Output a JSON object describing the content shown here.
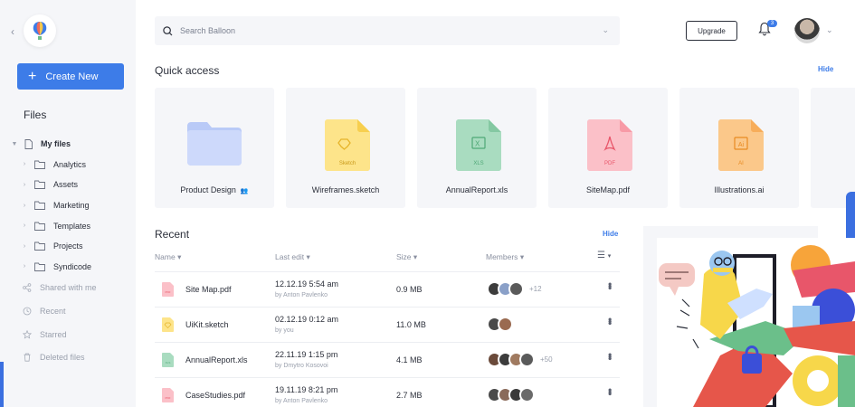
{
  "sidebar": {
    "create_label": "Create New",
    "files_title": "Files",
    "my_files": "My files",
    "folders": [
      "Analytics",
      "Assets",
      "Marketing",
      "Templates",
      "Projects",
      "Syndicode"
    ],
    "nav": [
      {
        "label": "Shared with me",
        "icon": "share-icon"
      },
      {
        "label": "Recent",
        "icon": "clock-icon"
      },
      {
        "label": "Starred",
        "icon": "star-icon"
      },
      {
        "label": "Deleted files",
        "icon": "trash-icon"
      }
    ]
  },
  "header": {
    "search_placeholder": "Search Balloon",
    "upgrade_label": "Upgrade",
    "notification_count": "3"
  },
  "quick_access": {
    "title": "Quick access",
    "hide_label": "Hide",
    "items": [
      {
        "name": "Product Design",
        "type": "folder"
      },
      {
        "name": "Wireframes.sketch",
        "type": "sketch",
        "tag": "Sketch"
      },
      {
        "name": "AnnualReport.xls",
        "type": "xls",
        "tag": "XLS"
      },
      {
        "name": "SiteMap.pdf",
        "type": "pdf",
        "tag": "PDF"
      },
      {
        "name": "Illustrations.ai",
        "type": "ai",
        "tag": "AI"
      }
    ]
  },
  "recent": {
    "title": "Recent",
    "hide_label": "Hide",
    "columns": {
      "name": "Name",
      "last_edit": "Last edit",
      "size": "Size",
      "members": "Members"
    },
    "rows": [
      {
        "name": "Site Map.pdf",
        "type": "pdf",
        "date": "12.12.19 5:54 am",
        "by": "by Anton Pavlenko",
        "size": "0.9 MB",
        "members": 3,
        "extra": "+12"
      },
      {
        "name": "UiKit.sketch",
        "type": "sketch",
        "date": "02.12.19 0:12 am",
        "by": "by you",
        "size": "11.0 MB",
        "members": 2,
        "extra": ""
      },
      {
        "name": "AnnualReport.xls",
        "type": "xls",
        "date": "22.11.19 1:15 pm",
        "by": "by Dmytro Kosovoi",
        "size": "4.1 MB",
        "members": 4,
        "extra": "+50"
      },
      {
        "name": "CaseStudies.pdf",
        "type": "pdf",
        "date": "19.11.19 8:21 pm",
        "by": "by Anton Pavlenko",
        "size": "2.7 MB",
        "members": 4,
        "extra": ""
      }
    ]
  },
  "colors": {
    "accent": "#3d7ce8",
    "folder": "#c9d6fb",
    "sketch": "#fde48a",
    "xls": "#a9dcc0",
    "pdf": "#fbc0c8",
    "ai": "#fbc88a"
  }
}
